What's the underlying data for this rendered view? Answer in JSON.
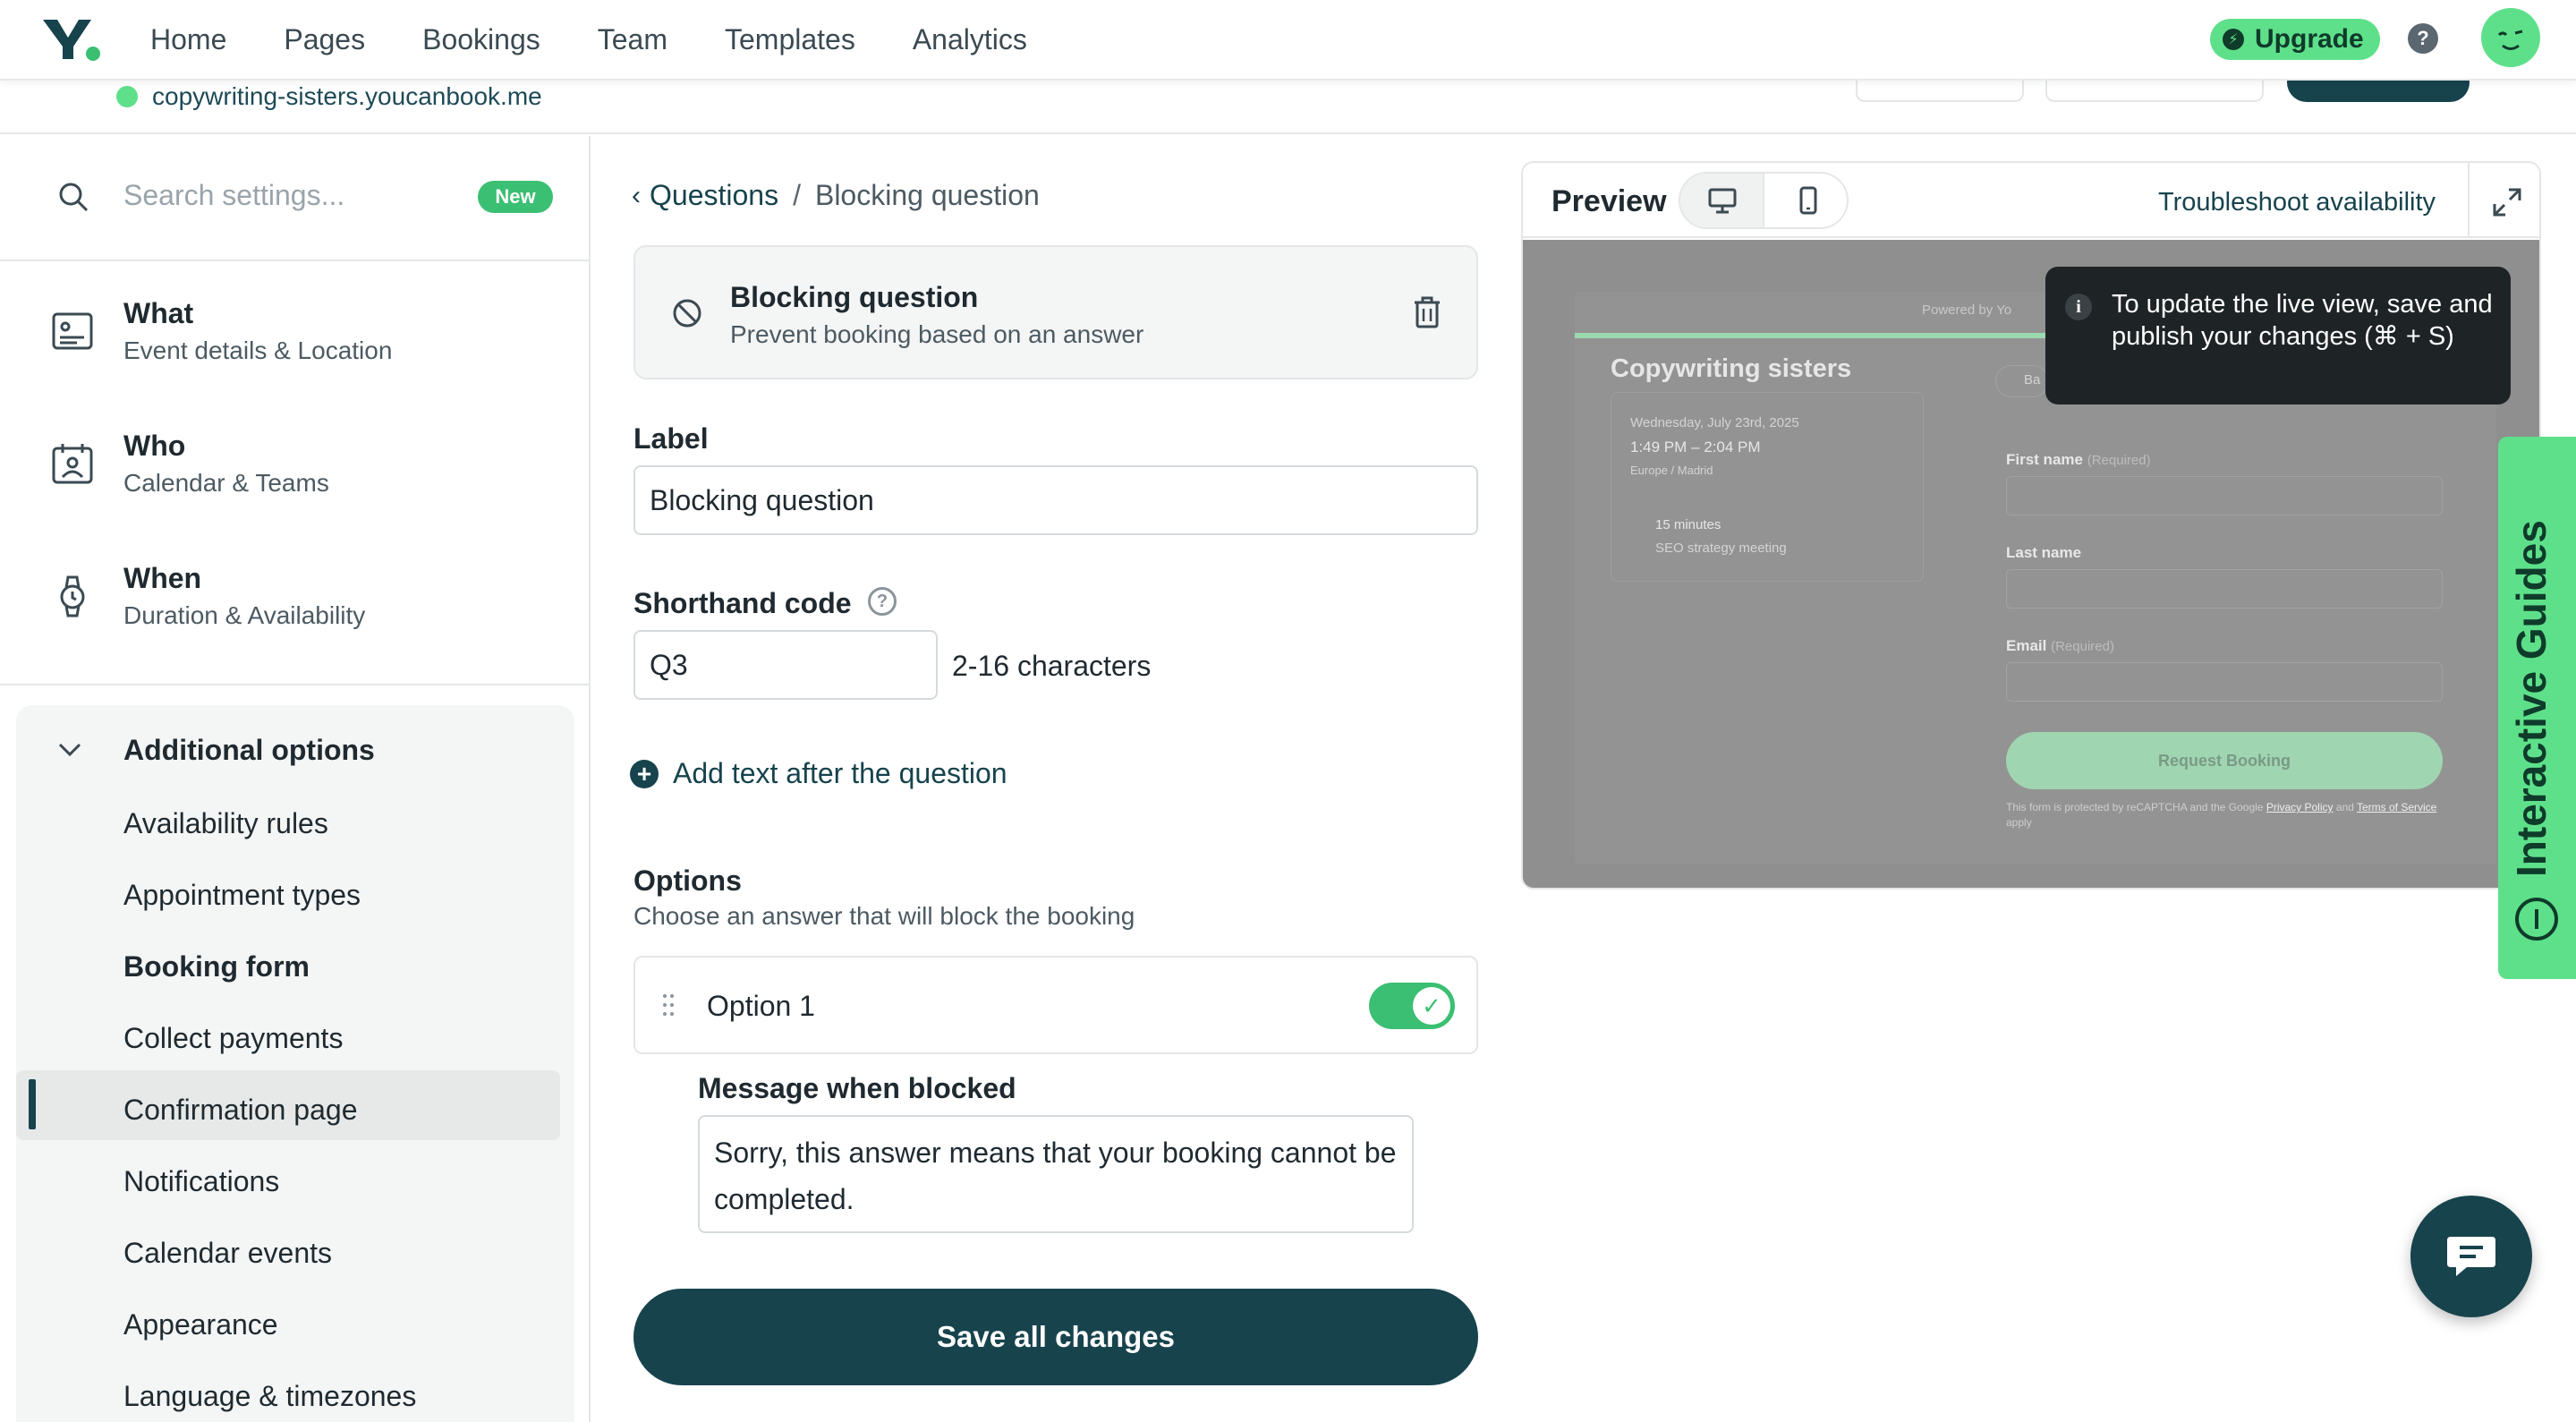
{
  "nav": {
    "items": [
      "Home",
      "Pages",
      "Bookings",
      "Team",
      "Templates",
      "Analytics"
    ],
    "upgrade": "Upgrade",
    "help": "?"
  },
  "subheader": {
    "url": "copywriting-sisters.youcanbook.me"
  },
  "sidebar": {
    "search_placeholder": "Search settings...",
    "new_badge": "New",
    "sections": [
      {
        "title": "What",
        "subtitle": "Event details & Location",
        "icon": "id-card-icon"
      },
      {
        "title": "Who",
        "subtitle": "Calendar & Teams",
        "icon": "calendar-person-icon"
      },
      {
        "title": "When",
        "subtitle": "Duration & Availability",
        "icon": "watch-icon"
      }
    ],
    "additional_title": "Additional options",
    "options": [
      "Availability rules",
      "Appointment types",
      "Booking form",
      "Collect payments",
      "Confirmation page",
      "Notifications",
      "Calendar events",
      "Appearance",
      "Language & timezones"
    ],
    "active_option": "Booking form"
  },
  "form": {
    "breadcrumb_parent": "Questions",
    "breadcrumb_sep": "/",
    "breadcrumb_current": "Blocking question",
    "card_title": "Blocking question",
    "card_subtitle": "Prevent booking based on an answer",
    "label_title": "Label",
    "label_value": "Blocking question",
    "shorthand_title": "Shorthand code",
    "shorthand_value": "Q3",
    "shorthand_hint": "2-16 characters",
    "add_text": "Add text after the question",
    "options_title": "Options",
    "options_subtitle": "Choose an answer that will block the booking",
    "option1_label": "Option 1",
    "option1_enabled": true,
    "blocked_title": "Message when blocked",
    "blocked_message": "Sorry, this answer means that your booking cannot be completed.",
    "save": "Save all changes"
  },
  "preview": {
    "title": "Preview",
    "troubleshoot": "Troubleshoot availability",
    "powered": "Powered by Yo",
    "company": "Copywriting sisters",
    "date": "Wednesday, July 23rd, 2025",
    "time": "1:49 PM – 2:04 PM",
    "tz": "Europe / Madrid",
    "duration": "15 minutes",
    "meeting": "SEO strategy meeting",
    "back": "Ba",
    "first_name": "First name",
    "last_name": "Last name",
    "email": "Email",
    "required": "(Required)",
    "request": "Request Booking",
    "fine1": "This form is protected by reCAPTCHA and the Google",
    "privacy": "Privacy Policy",
    "and": "and",
    "terms": "Terms of Service",
    "apply": "apply"
  },
  "tooltip": {
    "icon_letter": "i",
    "text": "To update the live view, save and publish your changes (⌘ + S)"
  },
  "guides": {
    "label": "Interactive Guides"
  },
  "colors": {
    "brand_dark": "#17434d",
    "brand_green": "#5ee08a",
    "toggle_green": "#3bbf72"
  }
}
